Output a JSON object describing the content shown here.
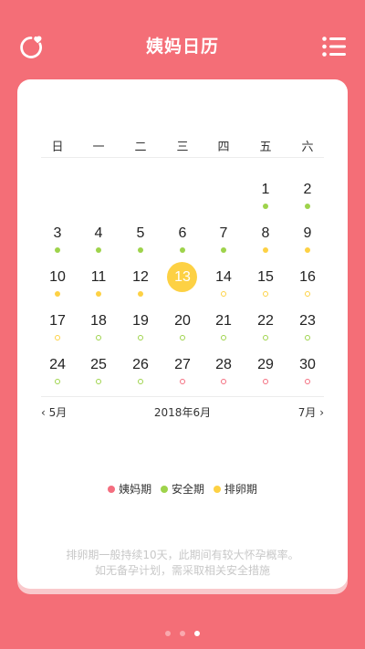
{
  "header": {
    "title": "姨妈日历",
    "logo_icon": "heart-refresh-icon",
    "menu_icon": "list-menu-icon"
  },
  "colors": {
    "period": "#F46E7F",
    "safe": "#9ED34B",
    "ovulation": "#FDD144",
    "background": "#F46E77"
  },
  "calendar": {
    "weekdays": [
      "日",
      "一",
      "二",
      "三",
      "四",
      "五",
      "六"
    ],
    "days": [
      {
        "n": "1",
        "col": 5,
        "row": 0,
        "dot": "safe",
        "style": "filled"
      },
      {
        "n": "2",
        "col": 6,
        "row": 0,
        "dot": "safe",
        "style": "filled"
      },
      {
        "n": "3",
        "col": 0,
        "row": 1,
        "dot": "safe",
        "style": "filled"
      },
      {
        "n": "4",
        "col": 1,
        "row": 1,
        "dot": "safe",
        "style": "filled"
      },
      {
        "n": "5",
        "col": 2,
        "row": 1,
        "dot": "safe",
        "style": "filled"
      },
      {
        "n": "6",
        "col": 3,
        "row": 1,
        "dot": "safe",
        "style": "filled"
      },
      {
        "n": "7",
        "col": 4,
        "row": 1,
        "dot": "safe",
        "style": "filled"
      },
      {
        "n": "8",
        "col": 5,
        "row": 1,
        "dot": "ovulation",
        "style": "filled"
      },
      {
        "n": "9",
        "col": 6,
        "row": 1,
        "dot": "ovulation",
        "style": "filled"
      },
      {
        "n": "10",
        "col": 0,
        "row": 2,
        "dot": "ovulation",
        "style": "filled"
      },
      {
        "n": "11",
        "col": 1,
        "row": 2,
        "dot": "ovulation",
        "style": "filled"
      },
      {
        "n": "12",
        "col": 2,
        "row": 2,
        "dot": "ovulation",
        "style": "filled"
      },
      {
        "n": "13",
        "col": 3,
        "row": 2,
        "dot": "none",
        "style": "today"
      },
      {
        "n": "14",
        "col": 4,
        "row": 2,
        "dot": "ovulation",
        "style": "outline"
      },
      {
        "n": "15",
        "col": 5,
        "row": 2,
        "dot": "ovulation",
        "style": "outline"
      },
      {
        "n": "16",
        "col": 6,
        "row": 2,
        "dot": "ovulation",
        "style": "outline"
      },
      {
        "n": "17",
        "col": 0,
        "row": 3,
        "dot": "ovulation",
        "style": "outline"
      },
      {
        "n": "18",
        "col": 1,
        "row": 3,
        "dot": "safe",
        "style": "outline"
      },
      {
        "n": "19",
        "col": 2,
        "row": 3,
        "dot": "safe",
        "style": "outline"
      },
      {
        "n": "20",
        "col": 3,
        "row": 3,
        "dot": "safe",
        "style": "outline"
      },
      {
        "n": "21",
        "col": 4,
        "row": 3,
        "dot": "safe",
        "style": "outline"
      },
      {
        "n": "22",
        "col": 5,
        "row": 3,
        "dot": "safe",
        "style": "outline"
      },
      {
        "n": "23",
        "col": 6,
        "row": 3,
        "dot": "safe",
        "style": "outline"
      },
      {
        "n": "24",
        "col": 0,
        "row": 4,
        "dot": "safe",
        "style": "outline"
      },
      {
        "n": "25",
        "col": 1,
        "row": 4,
        "dot": "safe",
        "style": "outline"
      },
      {
        "n": "26",
        "col": 2,
        "row": 4,
        "dot": "safe",
        "style": "outline"
      },
      {
        "n": "27",
        "col": 3,
        "row": 4,
        "dot": "period",
        "style": "outline"
      },
      {
        "n": "28",
        "col": 4,
        "row": 4,
        "dot": "period",
        "style": "outline"
      },
      {
        "n": "29",
        "col": 5,
        "row": 4,
        "dot": "period",
        "style": "outline"
      },
      {
        "n": "30",
        "col": 6,
        "row": 4,
        "dot": "period",
        "style": "outline"
      }
    ]
  },
  "month_nav": {
    "prev_label": "5月",
    "current_label": "2018年6月",
    "next_label": "7月"
  },
  "legend": [
    {
      "label": "姨妈期",
      "color": "#F46E7F"
    },
    {
      "label": "安全期",
      "color": "#9ED34B"
    },
    {
      "label": "排卵期",
      "color": "#FDD144"
    }
  ],
  "tips": {
    "line1": "排卵期一般持续10天，此期间有较大怀孕概率。",
    "line2": "如无备孕计划，需采取相关安全措施"
  },
  "pager": {
    "count": 3,
    "active": 2
  }
}
